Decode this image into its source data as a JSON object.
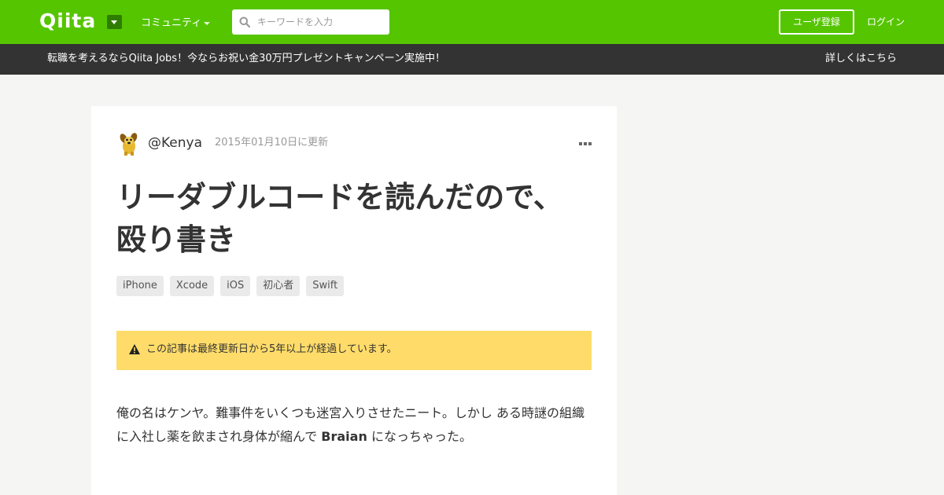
{
  "header": {
    "logo_text": "Qiita",
    "community_label": "コミュニティ",
    "search_placeholder": "キーワードを入力",
    "signup_label": "ユーザ登録",
    "login_label": "ログイン",
    "brand_color": "#55c500"
  },
  "banner": {
    "text": "転職を考えるならQiita Jobs！今ならお祝い金30万円プレゼントキャンペーン実施中！",
    "link_label": "詳しくはこちら"
  },
  "article": {
    "author": "@Kenya",
    "updated": "2015年01月10日に更新",
    "title": "リーダブルコードを読んだので、殴り書き",
    "tags": [
      "iPhone",
      "Xcode",
      "iOS",
      "初心者",
      "Swift"
    ],
    "notice": "この記事は最終更新日から5年以上が経過しています。",
    "body_before": "俺の名はケンヤ。難事件をいくつも迷宮入りさせたニート。しかし ある時謎の組織に入社し薬を飲まされ身体が縮んで ",
    "body_bold": "Braian",
    "body_after": " になっちゃった。"
  },
  "icons": {
    "menu": "chevron-down-icon",
    "search": "search-icon",
    "more": "more-icon",
    "warning": "warning-icon",
    "avatar": "dog-avatar"
  }
}
